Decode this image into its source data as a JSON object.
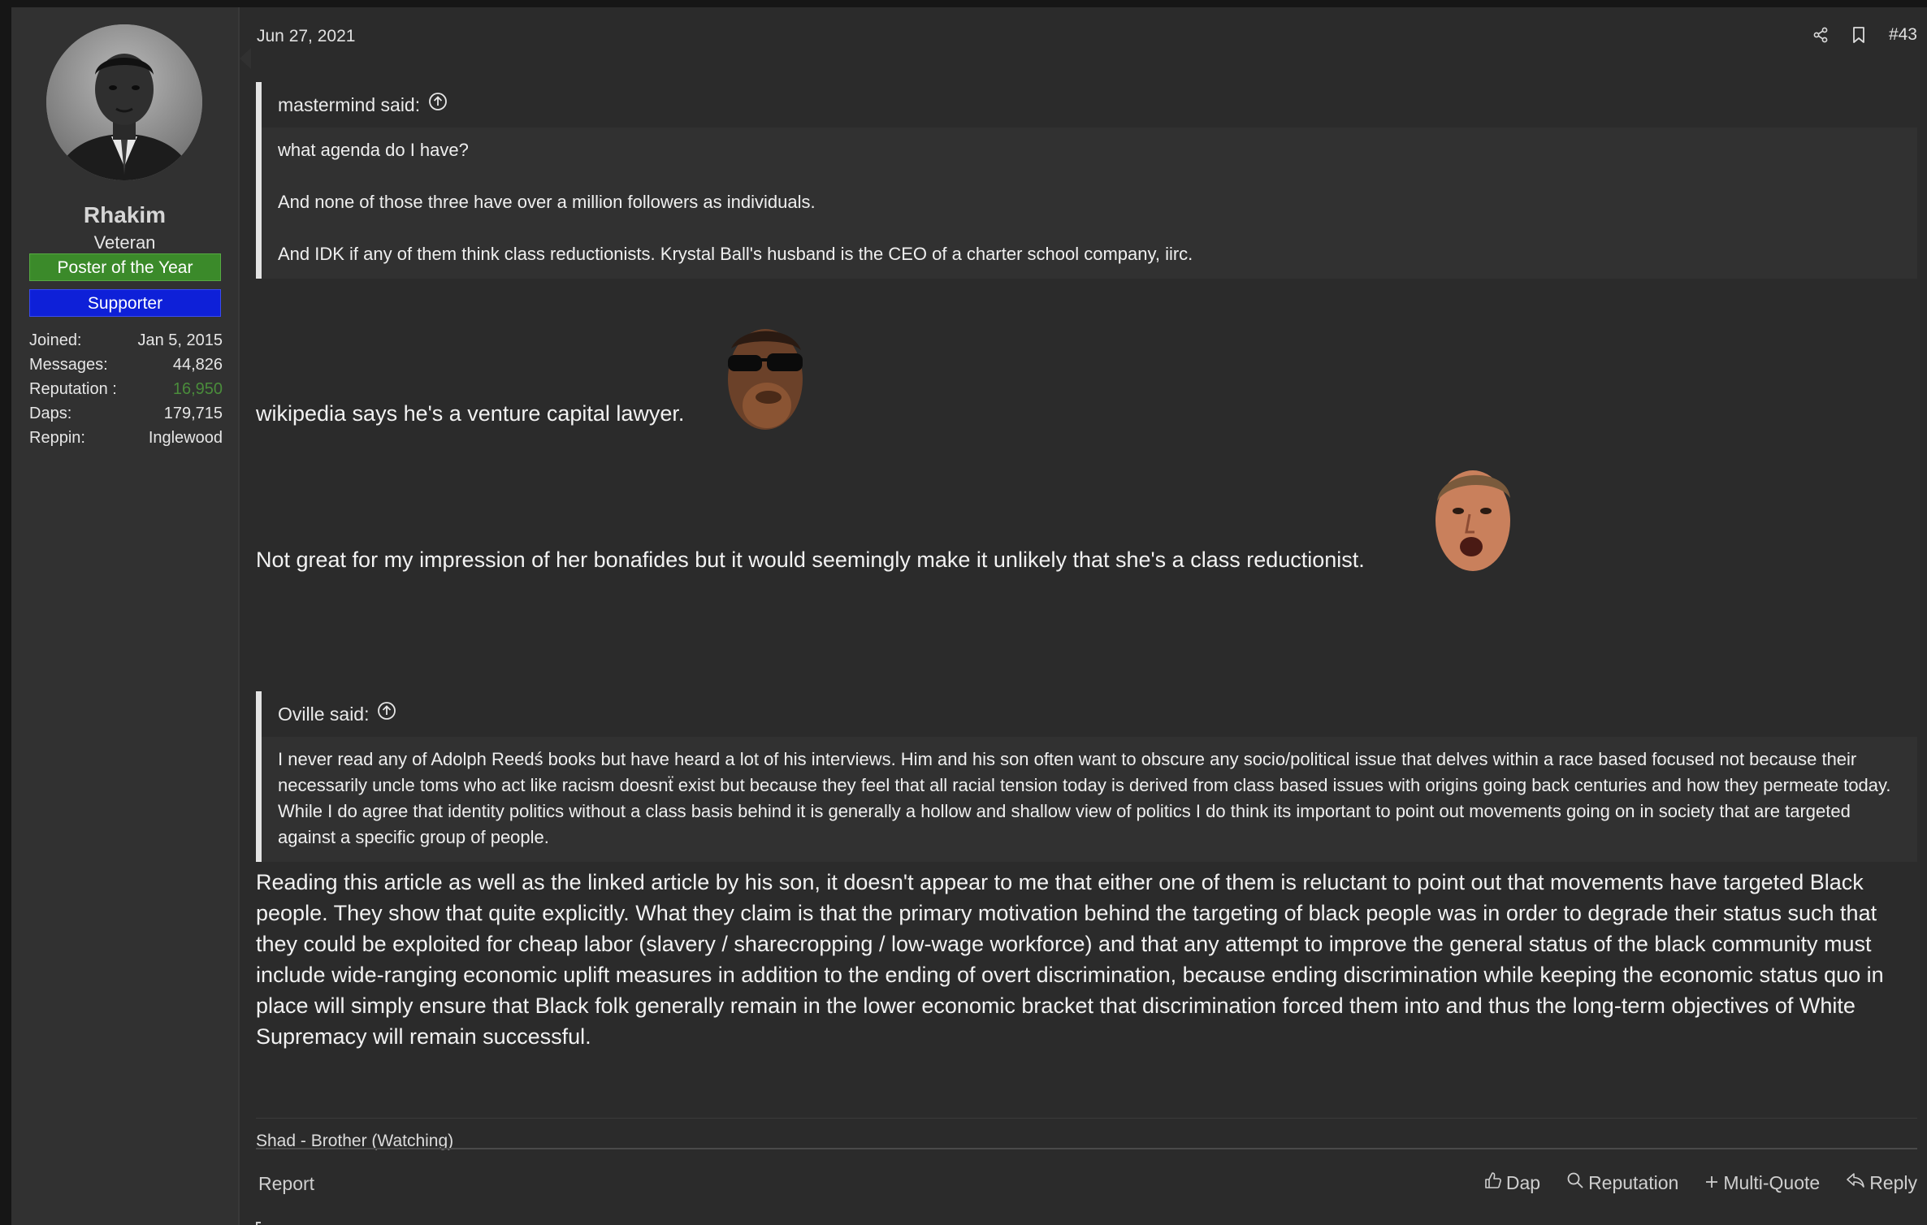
{
  "user": {
    "name": "Rhakim",
    "title": "Veteran",
    "banners": [
      "Poster of the Year",
      "Supporter"
    ],
    "stats": [
      {
        "label": "Joined:",
        "value": "Jan 5, 2015"
      },
      {
        "label": "Messages:",
        "value": "44,826"
      },
      {
        "label": "Reputation :",
        "value": "16,950"
      },
      {
        "label": "Daps:",
        "value": "179,715"
      },
      {
        "label": "Reppin:",
        "value": "Inglewood"
      }
    ]
  },
  "post": {
    "date": "Jun 27, 2021",
    "number": "#43",
    "quote1": {
      "author": "mastermind said:",
      "lines": [
        "what agenda do I have?",
        "And none of those three have over a million followers as individuals.",
        "And IDK if any of them think class reductionists. Krystal Ball's husband is the CEO of a charter school company, iirc."
      ]
    },
    "line1": "wikipedia says he's a venture capital lawyer.",
    "line2": "Not great for my impression of her bonafides but it would seemingly make it unlikely that she's a class reductionist.",
    "quote2": {
      "author": "Oville said:",
      "text": "I never read any of Adolph Reedś books but have heard a lot of his interviews. Him and his son often want to obscure any socio/political issue that delves within a race based focused not because their necessarily uncle toms who act like racism doesnẗ exist but because they feel that all racial tension today is derived from class based issues with origins going back centuries and how they permeate today. While I do agree that identity politics without a class basis behind it is generally a hollow and shallow view of politics I do think its important to point out movements going on in society that are targeted against a specific group of people."
    },
    "paragraph": "Reading this article as well as the linked article by his son, it doesn't appear to me that either one of them is reluctant to point out that movements have targeted Black people. They show that quite explicitly. What they claim is that the primary motivation behind the targeting of black people was in order to degrade their status such that they could be exploited for cheap labor (slavery / sharecropping / low-wage workforce) and that any attempt to improve the general status of the black community must include wide-ranging economic uplift measures in addition to the ending of overt discrimination, because ending discrimination while keeping the economic status quo in place will simply ensure that Black folk generally remain in the lower economic bracket that discrimination forced them into and thus the long-term objectives of White Supremacy will remain successful.",
    "signature": "Shad - Brother (Watching)"
  },
  "footer": {
    "report": "Report",
    "dap": "Dap",
    "reputation": "Reputation",
    "multiquote": "Multi-Quote",
    "reply": "Reply"
  },
  "icons": {
    "share": "share-icon",
    "bookmark": "bookmark-icon",
    "quote_link": "arrow-up-circle-icon",
    "dap": "thumbs-up-icon",
    "reputation": "search-icon",
    "multiquote": "plus-icon",
    "reply": "reply-icon"
  },
  "colors": {
    "page_bg": "#2b2b2b",
    "sidebar_bg": "#313131",
    "banner_green": "#3b8a2a",
    "banner_blue": "#0e20d8",
    "reputation_value": "#4a8c3b"
  }
}
